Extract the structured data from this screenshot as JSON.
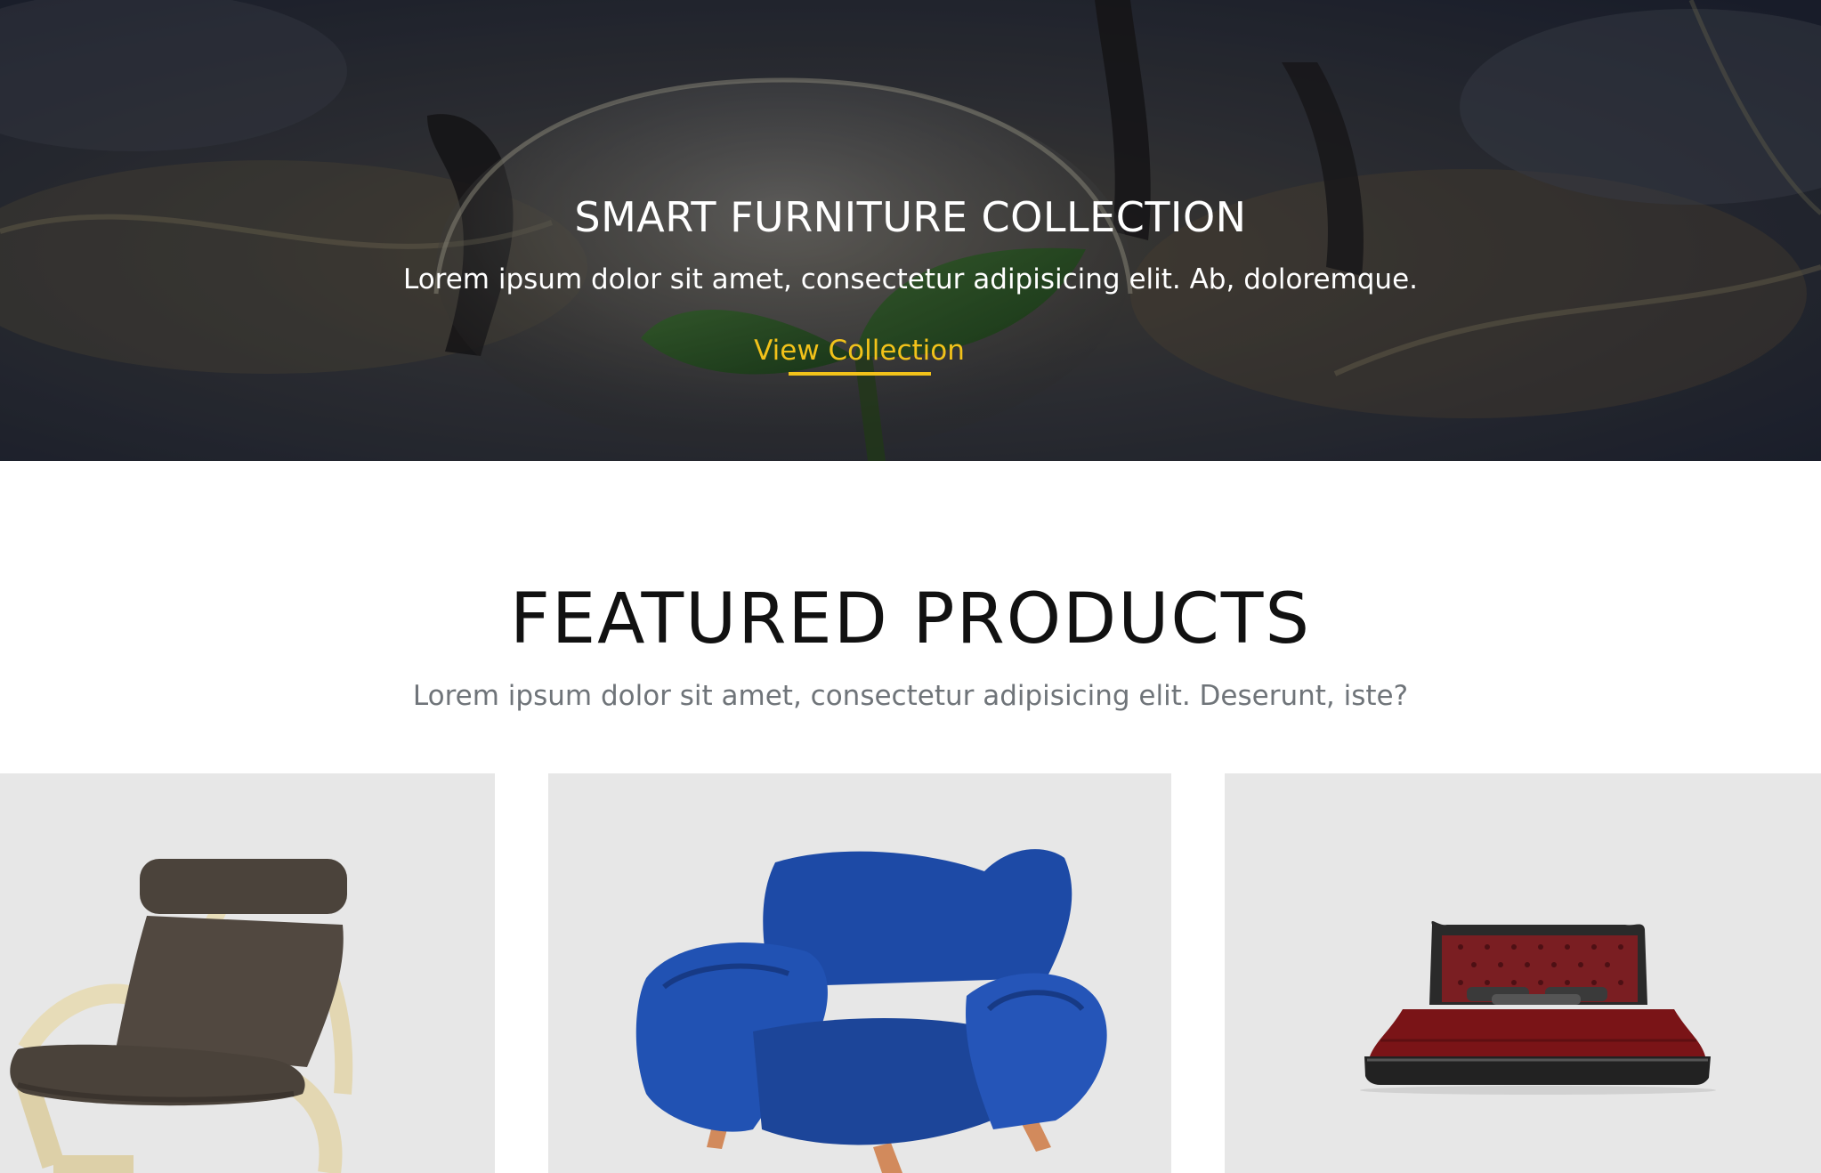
{
  "hero": {
    "title": "SMART FURNITURE COLLECTION",
    "subtitle": "Lorem ipsum dolor sit amet, consectetur adipisicing elit. Ab, doloremque.",
    "cta_label": "View Collection",
    "cta_color": "#f2c21a"
  },
  "featured": {
    "title": "FEATURED PRODUCTS",
    "subtitle": "Lorem ipsum dolor sit amet, consectetur adipisicing elit. Deserunt, iste?"
  },
  "products": [
    {
      "image": "armchair-poang-brown-leather"
    },
    {
      "image": "armchair-blue-velvet"
    },
    {
      "image": "bed-red-tufted"
    }
  ],
  "colors": {
    "card_background": "#e7e7e7",
    "heading": "#111111",
    "muted_text": "#6f7479"
  }
}
